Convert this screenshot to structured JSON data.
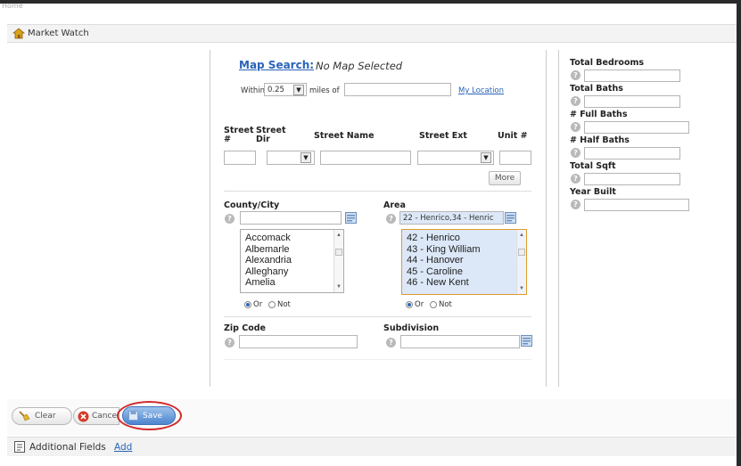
{
  "breadcrumb": "Home",
  "header": {
    "title": "Market Watch"
  },
  "map_search": {
    "label": "Map Search:",
    "status": "No Map Selected",
    "within_label": "Within",
    "within_value": "0.25",
    "miles_label": "miles of",
    "location_value": "",
    "my_location": "My Location"
  },
  "street": {
    "num_label": "Street #",
    "dir_label": "Street Dir",
    "name_label": "Street Name",
    "ext_label": "Street Ext",
    "unit_label": "Unit #",
    "more_button": "More"
  },
  "county": {
    "label": "County/City",
    "search_value": "",
    "options": [
      "Accomack",
      "Albemarle",
      "Alexandria",
      "Alleghany",
      "Amelia"
    ],
    "or_label": "Or",
    "not_label": "Not"
  },
  "area": {
    "label": "Area",
    "search_value": "22 - Henrico,34 - Henric",
    "options": [
      "42 - Henrico",
      "43 - King William",
      "44 - Hanover",
      "45 - Caroline",
      "46 - New Kent"
    ],
    "or_label": "Or",
    "not_label": "Not"
  },
  "zip": {
    "label": "Zip Code",
    "value": ""
  },
  "subdivision": {
    "label": "Subdivision",
    "value": ""
  },
  "right_fields": [
    {
      "label": "Total Bedrooms"
    },
    {
      "label": "Total Baths"
    },
    {
      "label": "# Full Baths"
    },
    {
      "label": "# Half Baths"
    },
    {
      "label": "Total Sqft"
    },
    {
      "label": "Year Built"
    }
  ],
  "actions": {
    "clear": "Clear",
    "cancel": "Cancel",
    "save": "Save"
  },
  "footer": {
    "label": "Additional Fields",
    "add": "Add"
  }
}
